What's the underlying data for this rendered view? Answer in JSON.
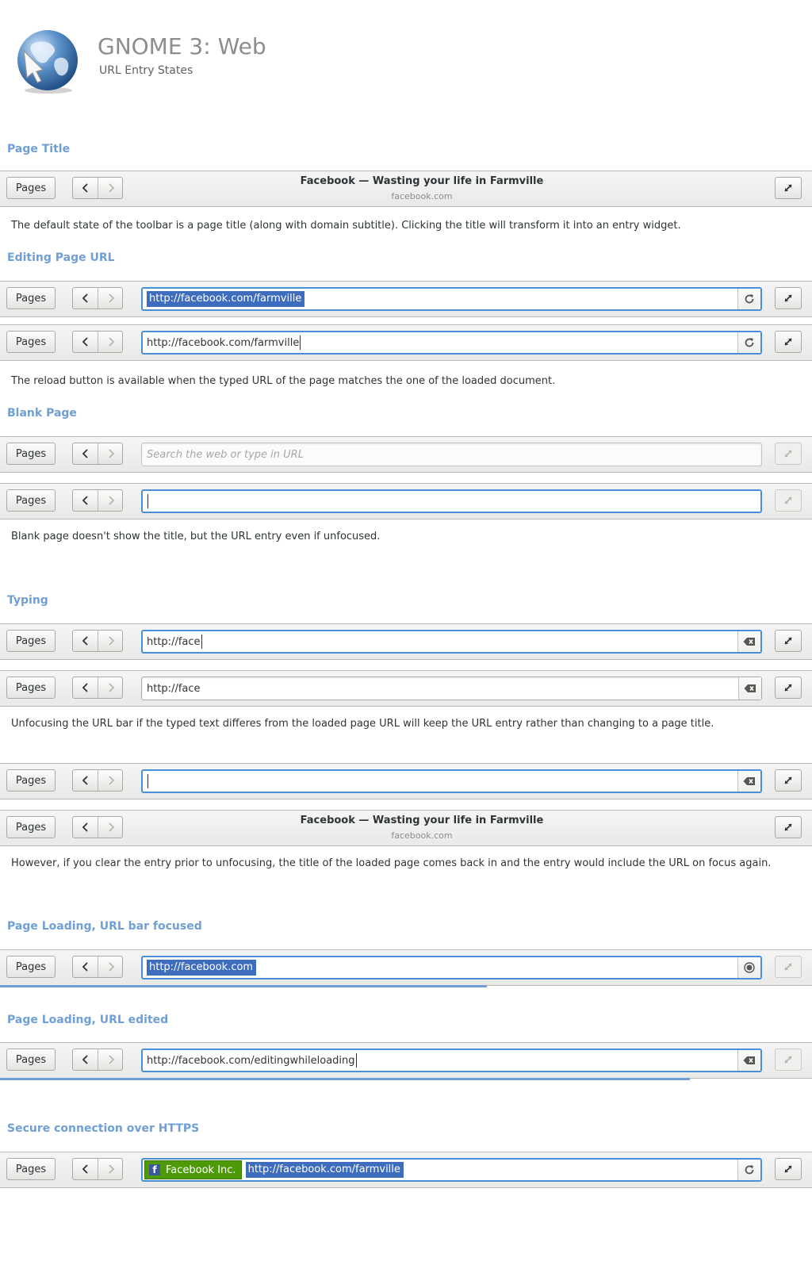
{
  "header": {
    "title": "GNOME 3: Web",
    "subtitle": "URL Entry States"
  },
  "toolbar_common": {
    "pages_label": "Pages"
  },
  "page": {
    "title": "Facebook — Wasting your life in Farmville",
    "domain": "facebook.com"
  },
  "sections": [
    {
      "heading": "Page Title",
      "description": "The default state of the toolbar is a page title (along with domain subtitle). Clicking the title will transform it into an entry widget."
    },
    {
      "heading": "Editing Page URL",
      "url": "http://facebook.com/farmville",
      "description": "The reload button is available when the typed URL of the page matches the one of the loaded document."
    },
    {
      "heading": "Blank Page",
      "placeholder": "Search the web or type in URL",
      "description": "Blank page doesn't show the title, but the URL entry even if unfocused."
    },
    {
      "heading": "Typing",
      "url": "http://face",
      "description": "Unfocusing the URL bar if the typed text differes from the loaded page URL will keep the URL entry rather than changing to a page title.",
      "description2": "However, if you clear the entry prior to unfocusing, the title of the loaded page comes back in and the entry would include the URL on focus again."
    },
    {
      "heading": "Page Loading, URL bar focused",
      "url": "http://facebook.com",
      "progress": 0.6
    },
    {
      "heading": "Page Loading, URL edited",
      "url": "http://facebook.com/editingwhileloading",
      "progress": 0.85
    },
    {
      "heading": "Secure connection over HTTPS",
      "owner": "Facebook Inc.",
      "url": "http://facebook.com/farmville"
    }
  ],
  "icons": {
    "reload": "reload-icon",
    "clear": "clear-icon",
    "stop": "stop-icon",
    "back": "back-arrow-icon",
    "forward": "forward-arrow-icon",
    "expand": "expand-icon"
  },
  "colors": {
    "accent": "#6f9fd6",
    "focus": "#4a90d9",
    "selection": "#3f6dbd",
    "secure_badge": "#4e9a06"
  }
}
